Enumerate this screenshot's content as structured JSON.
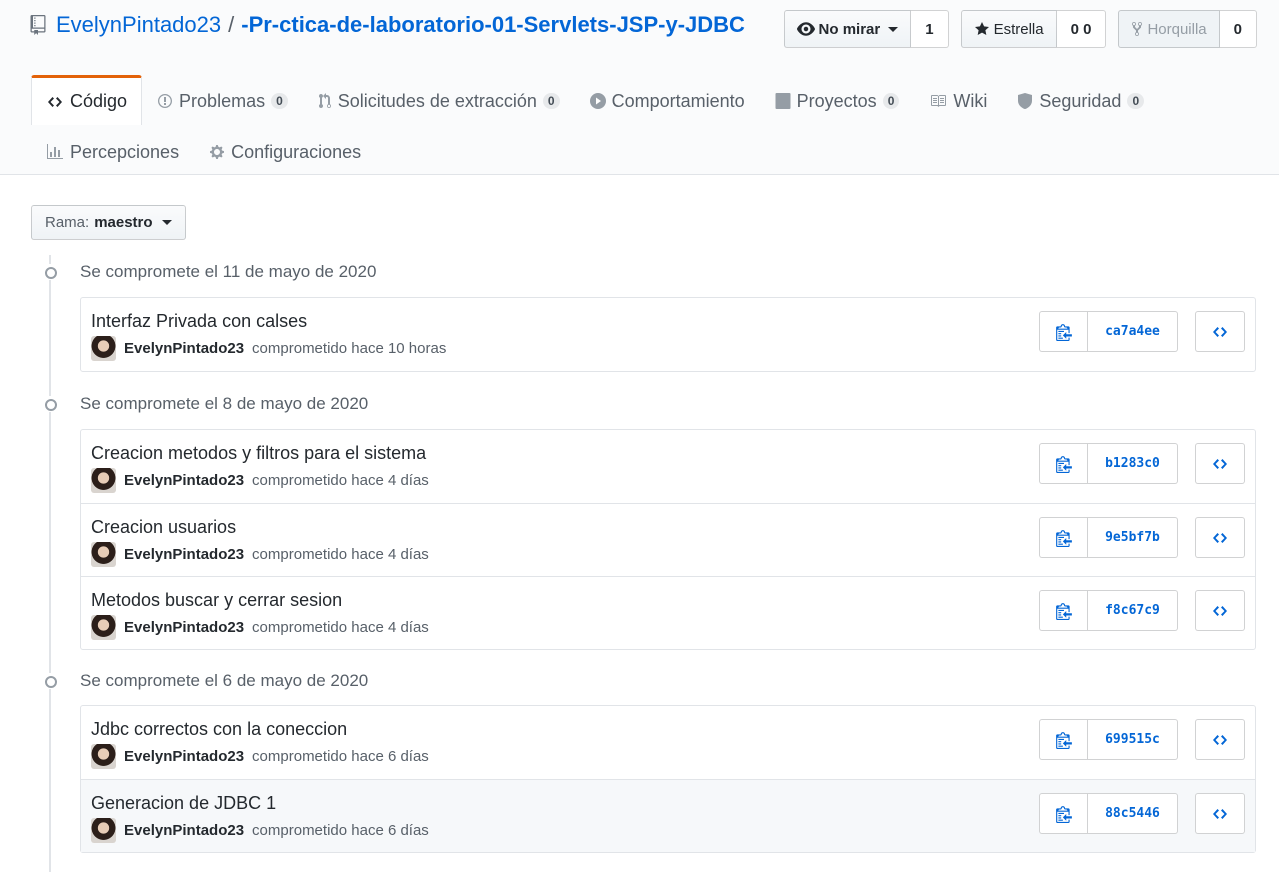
{
  "repo": {
    "owner": "EvelynPintado23",
    "separator": "/",
    "name": "-Pr-ctica-de-laboratorio-01-Servlets-JSP-y-JDBC"
  },
  "actions": {
    "watch_label": "No mirar",
    "watch_count": "1",
    "star_label": "Estrella",
    "star_count": "0 0",
    "fork_label": "Horquilla",
    "fork_count": "0"
  },
  "tabs": [
    {
      "label": "Código",
      "count": "",
      "icon": "code-icon"
    },
    {
      "label": "Problemas",
      "count": "0",
      "icon": "issue-icon"
    },
    {
      "label": "Solicitudes de extracción",
      "count": "0",
      "icon": "pull-request-icon"
    },
    {
      "label": "Comportamiento",
      "count": "",
      "icon": "play-icon"
    },
    {
      "label": "Proyectos",
      "count": "0",
      "icon": "project-icon"
    },
    {
      "label": "Wiki",
      "count": "",
      "icon": "book-icon"
    },
    {
      "label": "Seguridad",
      "count": "0",
      "icon": "shield-icon"
    },
    {
      "label": "Percepciones",
      "count": "",
      "icon": "graph-icon"
    },
    {
      "label": "Configuraciones",
      "count": "",
      "icon": "gear-icon"
    }
  ],
  "branch": {
    "prefix": "Rama:",
    "name": "maestro"
  },
  "groups": [
    {
      "heading": "Se compromete el 11 de mayo de 2020",
      "commits": [
        {
          "message": "Interfaz Privada con calses",
          "author": "EvelynPintado23",
          "when": "comprometido hace 10 horas",
          "sha": "ca7a4ee"
        }
      ]
    },
    {
      "heading": "Se compromete el 8 de mayo de 2020",
      "commits": [
        {
          "message": "Creacion metodos y filtros para el sistema",
          "author": "EvelynPintado23",
          "when": "comprometido hace 4 días",
          "sha": "b1283c0"
        },
        {
          "message": "Creacion usuarios",
          "author": "EvelynPintado23",
          "when": "comprometido hace 4 días",
          "sha": "9e5bf7b"
        },
        {
          "message": "Metodos buscar y cerrar sesion",
          "author": "EvelynPintado23",
          "when": "comprometido hace 4 días",
          "sha": "f8c67c9"
        }
      ]
    },
    {
      "heading": "Se compromete el 6 de mayo de 2020",
      "commits": [
        {
          "message": "Jdbc correctos con la coneccion",
          "author": "EvelynPintado23",
          "when": "comprometido hace 6 días",
          "sha": "699515c"
        },
        {
          "message": "Generacion de JDBC 1",
          "author": "EvelynPintado23",
          "when": "comprometido hace 6 días",
          "sha": "88c5446"
        }
      ]
    }
  ],
  "colors": {
    "link": "#0366d6",
    "selected_tab_accent": "#e36209",
    "muted": "#586069"
  }
}
